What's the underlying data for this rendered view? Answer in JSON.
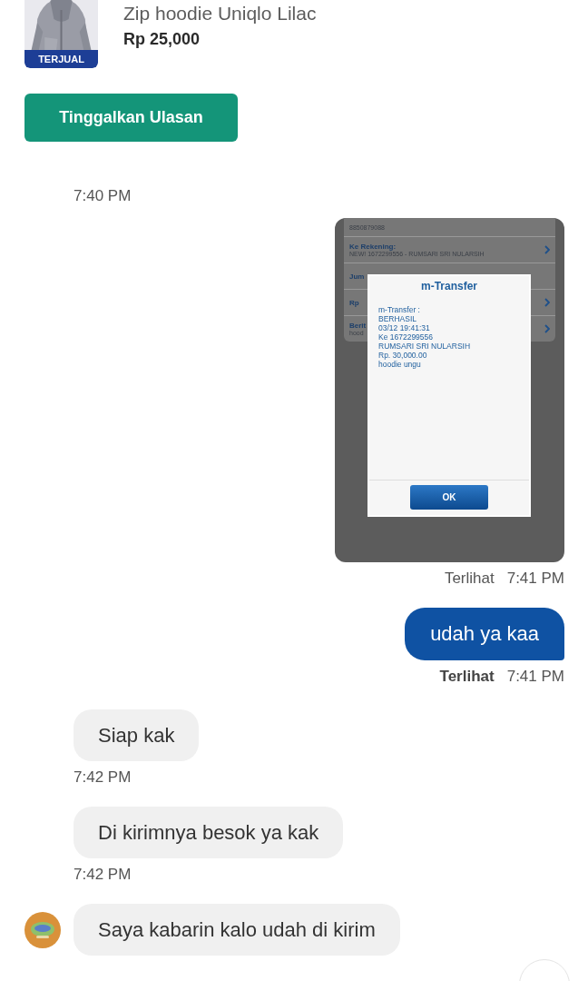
{
  "product": {
    "title": "Zip hoodie Uniqlo Lilac",
    "price": "Rp 25,000",
    "badge": "TERJUAL"
  },
  "review_button": "Tinggalkan Ulasan",
  "messages": [
    {
      "kind": "time",
      "text": "7:40 PM"
    },
    {
      "screenshot": {
        "rows": [
          {
            "label": "8850879088",
            "chevron": false
          },
          {
            "label": "Ke Rekening:",
            "value": "NEW! 1672299556 - RUMSARI SRI NULARSIH",
            "chevron": true
          },
          {
            "label": "Jum",
            "chevron": false
          },
          {
            "label": "Rp",
            "chevron": true
          },
          {
            "label": "Berit",
            "value": "hood",
            "chevron": true
          }
        ],
        "dialog": {
          "title": "m-Transfer",
          "lines": [
            "m-Transfer :",
            "BERHASIL",
            "03/12 19:41:31",
            "Ke 1672299556",
            "RUMSARI SRI NULARSIH",
            "Rp. 30,000.00",
            "hoodie ungu"
          ],
          "button": "OK"
        }
      }
    },
    {
      "kind": "status",
      "label": "Terlihat",
      "time": "7:41 PM",
      "bold": false
    },
    {
      "kind": "outgoing",
      "text": "udah ya kaa"
    },
    {
      "kind": "status",
      "label": "Terlihat",
      "time": "7:41 PM",
      "bold": true
    },
    {
      "kind": "incoming",
      "text": "Siap kak",
      "avatar": false
    },
    {
      "kind": "time",
      "text": "7:42 PM"
    },
    {
      "kind": "incoming",
      "text": "Di kirimnya besok ya kak",
      "avatar": false
    },
    {
      "kind": "time",
      "text": "7:42 PM"
    },
    {
      "kind": "incoming",
      "text": "Saya kabarin kalo udah di kirim",
      "avatar": true
    }
  ]
}
